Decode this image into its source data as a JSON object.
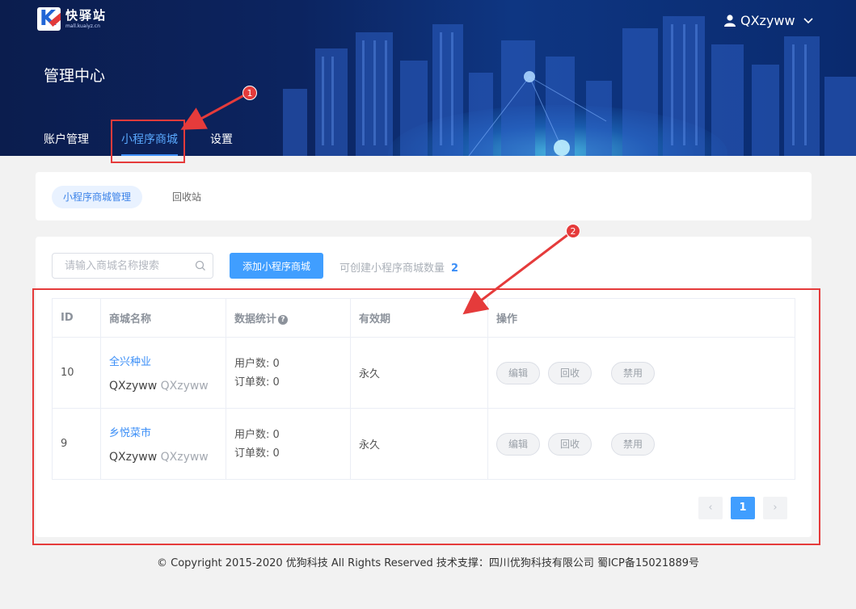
{
  "brand": {
    "name": "快驿站",
    "sub": "mall.kuaiyz.cn"
  },
  "user": {
    "name": "QXzyww"
  },
  "header": {
    "title": "管理中心"
  },
  "nav": [
    {
      "label": "账户管理"
    },
    {
      "label": "小程序商城",
      "active": true
    },
    {
      "label": "设置"
    }
  ],
  "subtabs": [
    {
      "label": "小程序商城管理",
      "active": true
    },
    {
      "label": "回收站"
    }
  ],
  "toolbar": {
    "search_placeholder": "请输入商城名称搜索",
    "add_label": "添加小程序商城",
    "quota_label": "可创建小程序商城数量",
    "quota_value": "2"
  },
  "table": {
    "headers": [
      "ID",
      "商城名称",
      "数据统计",
      "有效期",
      "操作"
    ],
    "rows": [
      {
        "id": "10",
        "name": "全兴种业",
        "owner": "QXzyww",
        "owner_alt": "QXzyww",
        "users": "用户数: 0",
        "orders": "订单数: 0",
        "expiry": "永久",
        "actions": [
          "编辑",
          "回收",
          "禁用"
        ]
      },
      {
        "id": "9",
        "name": "乡悦菜市",
        "owner": "QXzyww",
        "owner_alt": "QXzyww",
        "users": "用户数: 0",
        "orders": "订单数: 0",
        "expiry": "永久",
        "actions": [
          "编辑",
          "回收",
          "禁用"
        ]
      }
    ]
  },
  "pagination": {
    "prev": "‹",
    "current": "1",
    "next": "›"
  },
  "footer": {
    "text": "© Copyright 2015-2020 优狗科技 All Rights Reserved 技术支撑：四川优狗科技有限公司 蜀ICP备15021889号"
  },
  "annotations": {
    "marker1": "1",
    "marker2": "2"
  },
  "colors": {
    "accent": "#409eff",
    "annotation": "#e53b3b",
    "header_bg": "#0c2460"
  }
}
